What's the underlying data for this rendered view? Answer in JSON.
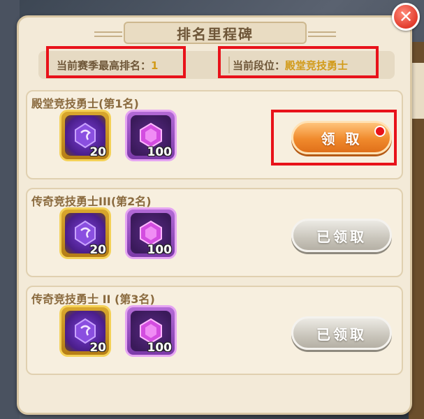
{
  "dialog": {
    "title": "排名里程碑",
    "close_label": "✕"
  },
  "info": {
    "best_rank_label": "当前赛季最高排名：",
    "best_rank_value": "1",
    "tier_label": "当前段位：",
    "tier_value": "殿堂竞技勇士"
  },
  "rewards": [
    {
      "title": "殿堂竞技勇士(第1名)",
      "items": [
        {
          "icon": "rune-stone-icon",
          "count": "20"
        },
        {
          "icon": "purple-gem-icon",
          "count": "100"
        }
      ],
      "button_label": "领 取",
      "button_state": "claimable",
      "has_red_dot": true
    },
    {
      "title": "传奇竞技勇士III(第2名)",
      "items": [
        {
          "icon": "rune-stone-icon",
          "count": "20"
        },
        {
          "icon": "purple-gem-icon",
          "count": "100"
        }
      ],
      "button_label": "已领取",
      "button_state": "claimed",
      "has_red_dot": false
    },
    {
      "title": "传奇竞技勇士 II (第3名)",
      "items": [
        {
          "icon": "rune-stone-icon",
          "count": "20"
        },
        {
          "icon": "purple-gem-icon",
          "count": "100"
        }
      ],
      "button_label": "已领取",
      "button_state": "claimed",
      "has_red_dot": false
    }
  ],
  "colors": {
    "accent_orange": "#f08a2c",
    "highlight_red": "#e8121a",
    "panel_bg": "#f3ead8",
    "value_gold": "#d29b1a"
  }
}
